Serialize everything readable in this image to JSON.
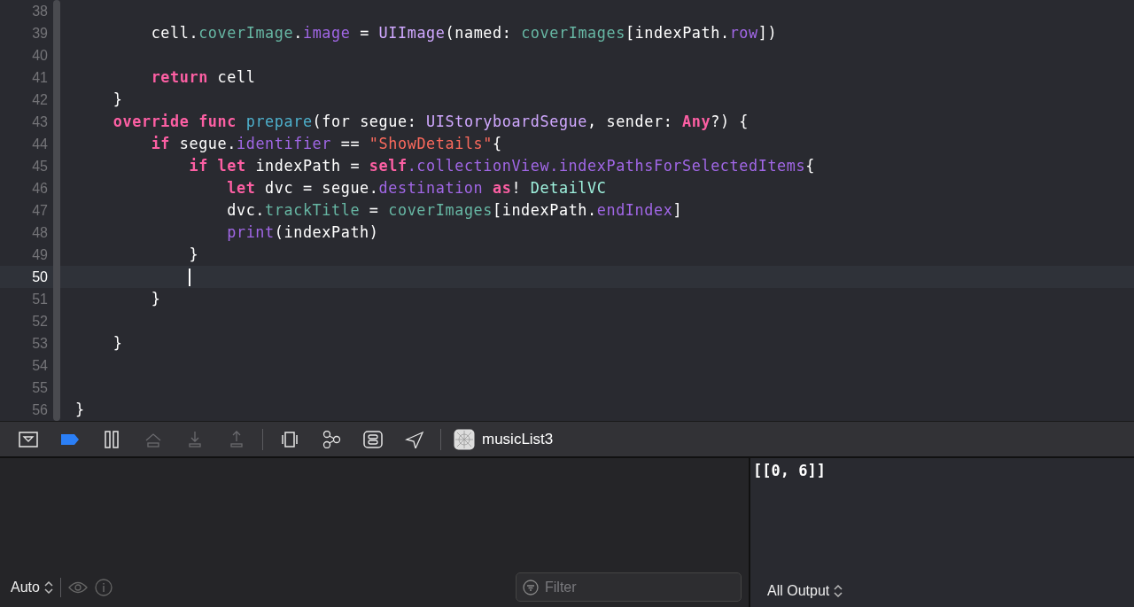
{
  "editor": {
    "lines": [
      {
        "number": "38",
        "current": false
      },
      {
        "number": "39",
        "current": false,
        "tokens": [
          {
            "text": "        cell.",
            "kind": "plain"
          },
          {
            "text": "coverImage",
            "kind": "project"
          },
          {
            "text": ".",
            "kind": "plain"
          },
          {
            "text": "image",
            "kind": "system"
          },
          {
            "text": " = ",
            "kind": "plain"
          },
          {
            "text": "UIImage",
            "kind": "systype"
          },
          {
            "text": "(named: ",
            "kind": "plain"
          },
          {
            "text": "coverImages",
            "kind": "project"
          },
          {
            "text": "[indexPath.",
            "kind": "plain"
          },
          {
            "text": "row",
            "kind": "system"
          },
          {
            "text": "])",
            "kind": "plain"
          }
        ]
      },
      {
        "number": "40",
        "current": false
      },
      {
        "number": "41",
        "current": false,
        "tokens": [
          {
            "text": "        return",
            "kind": "keyword"
          },
          {
            "text": " cell",
            "kind": "plain"
          }
        ]
      },
      {
        "number": "42",
        "current": false,
        "tokens": [
          {
            "text": "    }",
            "kind": "plain"
          }
        ]
      },
      {
        "number": "43",
        "current": false,
        "tokens": [
          {
            "text": "    override func",
            "kind": "keyword"
          },
          {
            "text": " prepare",
            "kind": "declaration"
          },
          {
            "text": "(for segue: ",
            "kind": "plain"
          },
          {
            "text": "UIStoryboardSegue",
            "kind": "systype"
          },
          {
            "text": ", sender: ",
            "kind": "plain"
          },
          {
            "text": "Any",
            "kind": "keyword"
          },
          {
            "text": "?) {",
            "kind": "plain"
          }
        ]
      },
      {
        "number": "44",
        "current": false,
        "tokens": [
          {
            "text": "        if",
            "kind": "keyword"
          },
          {
            "text": " segue.",
            "kind": "plain"
          },
          {
            "text": "identifier",
            "kind": "system"
          },
          {
            "text": " == ",
            "kind": "plain"
          },
          {
            "text": "\"ShowDetails\"",
            "kind": "string"
          },
          {
            "text": "{",
            "kind": "plain"
          }
        ]
      },
      {
        "number": "45",
        "current": false,
        "tokens": [
          {
            "text": "            if let",
            "kind": "keyword"
          },
          {
            "text": " indexPath = ",
            "kind": "plain"
          },
          {
            "text": "self",
            "kind": "keyword"
          },
          {
            "text": ".collectionView.indexPathsForSelectedItems",
            "kind": "system"
          },
          {
            "text": "{",
            "kind": "plain"
          }
        ]
      },
      {
        "number": "46",
        "current": false,
        "tokens": [
          {
            "text": "                let",
            "kind": "keyword"
          },
          {
            "text": " dvc = segue.",
            "kind": "plain"
          },
          {
            "text": "destination",
            "kind": "system"
          },
          {
            "text": " as",
            "kind": "keyword"
          },
          {
            "text": "! ",
            "kind": "plain"
          },
          {
            "text": "DetailVC",
            "kind": "projtype"
          }
        ]
      },
      {
        "number": "47",
        "current": false,
        "tokens": [
          {
            "text": "                dvc.",
            "kind": "plain"
          },
          {
            "text": "trackTitle",
            "kind": "project"
          },
          {
            "text": " = ",
            "kind": "plain"
          },
          {
            "text": "coverImages",
            "kind": "project"
          },
          {
            "text": "[indexPath.",
            "kind": "plain"
          },
          {
            "text": "endIndex",
            "kind": "system"
          },
          {
            "text": "]",
            "kind": "plain"
          }
        ]
      },
      {
        "number": "48",
        "current": false,
        "tokens": [
          {
            "text": "                print",
            "kind": "system"
          },
          {
            "text": "(indexPath)",
            "kind": "plain"
          }
        ]
      },
      {
        "number": "49",
        "current": false,
        "tokens": [
          {
            "text": "            }",
            "kind": "plain"
          }
        ]
      },
      {
        "number": "50",
        "current": true
      },
      {
        "number": "51",
        "current": false,
        "tokens": [
          {
            "text": "        }",
            "kind": "plain"
          }
        ]
      },
      {
        "number": "52",
        "current": false
      },
      {
        "number": "53",
        "current": false,
        "tokens": [
          {
            "text": "    }",
            "kind": "plain"
          }
        ]
      },
      {
        "number": "54",
        "current": false
      },
      {
        "number": "55",
        "current": false
      },
      {
        "number": "56",
        "current": false,
        "tokens": [
          {
            "text": "}",
            "kind": "plain"
          }
        ]
      }
    ]
  },
  "debug_bar": {
    "buttons": [
      {
        "kind": "hide-area",
        "on": false,
        "disabled": false
      },
      {
        "kind": "breakpoints",
        "on": true,
        "disabled": false
      },
      {
        "kind": "pause",
        "on": false,
        "disabled": false
      },
      {
        "kind": "step-over",
        "on": false,
        "disabled": true
      },
      {
        "kind": "step-into",
        "on": false,
        "disabled": true
      },
      {
        "kind": "step-out",
        "on": false,
        "disabled": true
      },
      {
        "kind": "separator"
      },
      {
        "kind": "view-debugger",
        "on": false,
        "disabled": false
      },
      {
        "kind": "memory-graph",
        "on": false,
        "disabled": false
      },
      {
        "kind": "environment",
        "on": false,
        "disabled": false
      },
      {
        "kind": "location",
        "on": false,
        "disabled": false
      },
      {
        "kind": "separator"
      }
    ],
    "target": "musicList3"
  },
  "variables_pane": {
    "scope": "Auto",
    "filter": {
      "placeholder": "Filter"
    }
  },
  "console": {
    "output": "[[0, 6]]",
    "mode": "All Output"
  }
}
